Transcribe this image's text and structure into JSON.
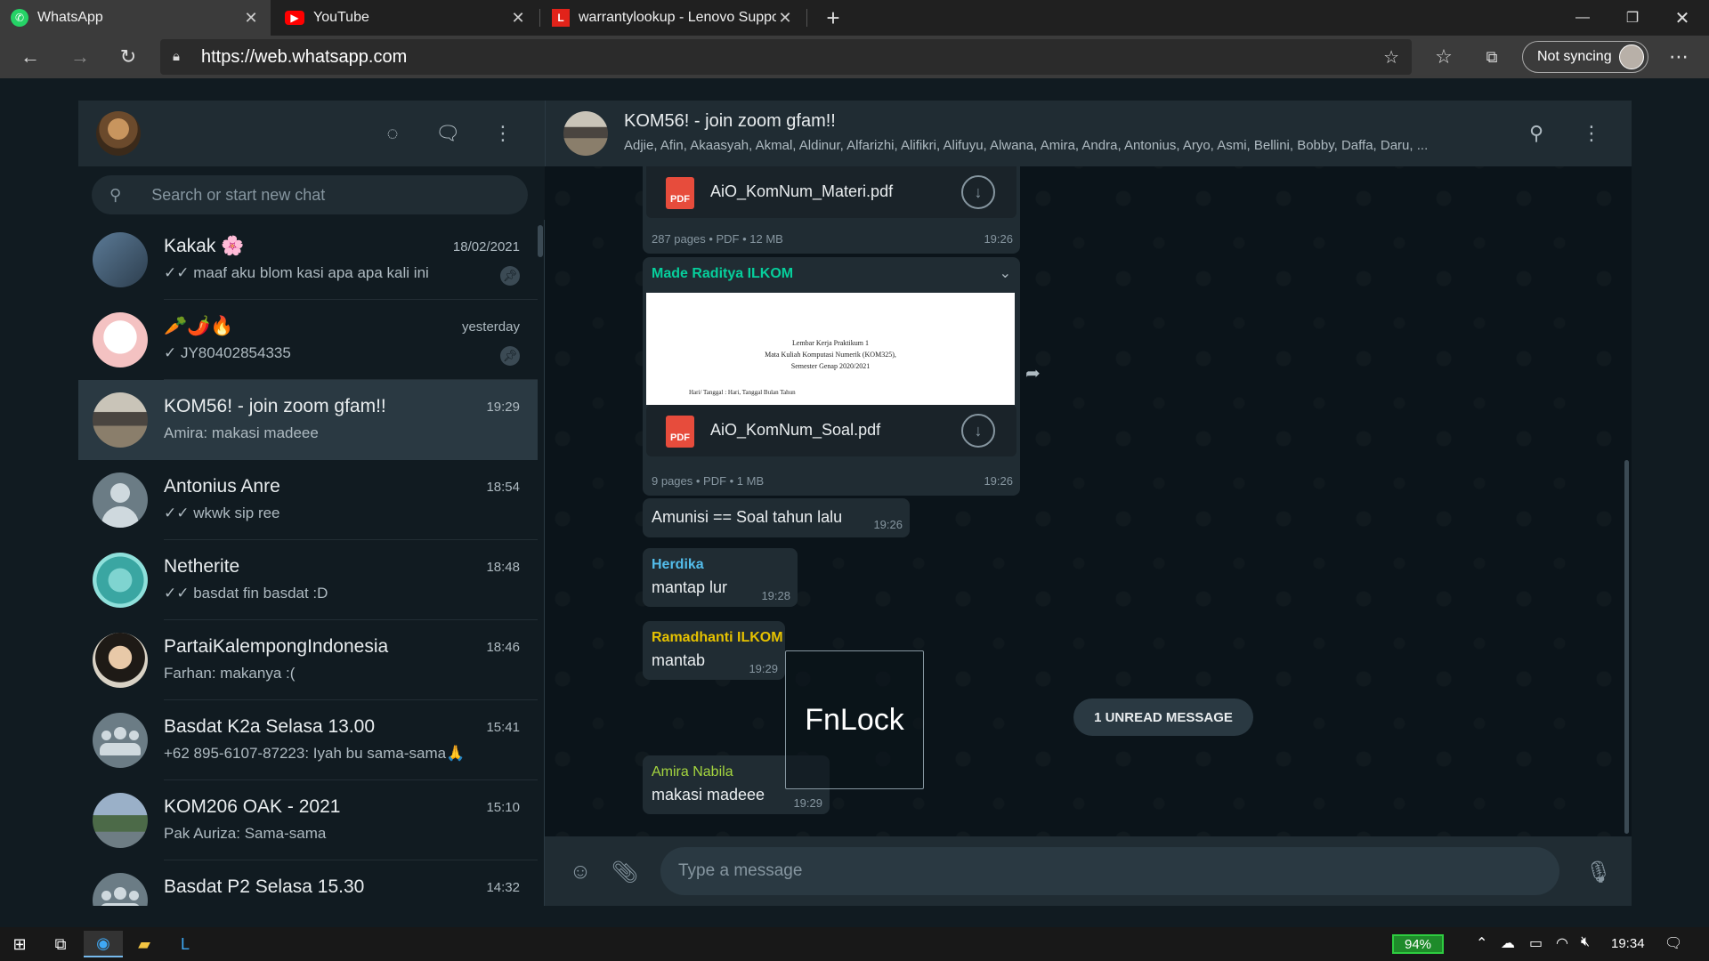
{
  "browser": {
    "tabs": [
      {
        "title": "WhatsApp",
        "icon": "whatsapp-icon"
      },
      {
        "title": "YouTube",
        "icon": "youtube-icon"
      },
      {
        "title": "warrantylookup - Lenovo Suppo",
        "icon": "lenovo-icon"
      }
    ],
    "url": "https://web.whatsapp.com",
    "sync_label": "Not syncing"
  },
  "sidebar": {
    "search_placeholder": "Search or start new chat",
    "chats": [
      {
        "name": "Kakak 🌸",
        "time": "18/02/2021",
        "last": "✓✓ maaf aku blom kasi apa apa kali ini",
        "pinned": true
      },
      {
        "name": "🥕🌶️🔥",
        "time": "yesterday",
        "last": "✓ JY80402854335",
        "pinned": true
      },
      {
        "name": "KOM56! - join zoom gfam!!",
        "time": "19:29",
        "last": "Amira: makasi madeee",
        "selected": true
      },
      {
        "name": "Antonius Anre",
        "time": "18:54",
        "last": "✓✓ wkwk sip ree"
      },
      {
        "name": "Netherite",
        "time": "18:48",
        "last": "✓✓ basdat fin basdat :D"
      },
      {
        "name": "PartaiKalempongIndonesia",
        "time": "18:46",
        "last": "Farhan: makanya :("
      },
      {
        "name": "Basdat K2a Selasa 13.00",
        "time": "15:41",
        "last": "+62 895-6107-87223: Iyah bu sama-sama🙏"
      },
      {
        "name": "KOM206 OAK - 2021",
        "time": "15:10",
        "last": "Pak Auriza: Sama-sama"
      },
      {
        "name": "Basdat P2 Selasa 15.30",
        "time": "14:32",
        "last": ""
      }
    ]
  },
  "conversation": {
    "title": "KOM56! - join zoom gfam!!",
    "members": "Adjie, Afin, Akaasyah, Akmal, Aldinur, Alfarizhi, Alifikri, Alifuyu, Alwana, Amira, Andra, Antonius, Aryo, Asmi, Bellini, Bobby, Daffa, Daru, ...",
    "messages": {
      "doc1": {
        "file": "AiO_KomNum_Materi.pdf",
        "meta": "287 pages • PDF • 12 MB",
        "time": "19:26"
      },
      "doc2": {
        "sender": "Made Raditya ILKOM",
        "file": "AiO_KomNum_Soal.pdf",
        "meta": "9 pages • PDF • 1 MB",
        "time": "19:26",
        "preview_lines": [
          "Lembar Kerja Praktikum 1",
          "Mata Kuliah Komputasi Numerik (KOM325),",
          "Semester Genap 2020/2021"
        ],
        "preview_small": "Hari/ Tanggal : Hari, Tanggal Bulan Tahun"
      },
      "m3": {
        "text": "Amunisi == Soal tahun lalu",
        "time": "19:26"
      },
      "m4": {
        "sender": "Herdika",
        "text": "mantap lur",
        "time": "19:28"
      },
      "m5": {
        "sender": "Ramadhanti ILKOM",
        "text": "mantab",
        "time": "19:29"
      },
      "m6": {
        "sender": "Amira Nabila",
        "text": "makasi madeee",
        "time": "19:29"
      }
    },
    "unread_label": "1 UNREAD MESSAGE",
    "input_placeholder": "Type a message"
  },
  "overlay": {
    "fnlock": "FnLock"
  },
  "taskbar": {
    "battery": "94%",
    "clock": "19:34"
  },
  "colors": {
    "sender_green": "#53bdeb",
    "accent": "#00a884"
  }
}
